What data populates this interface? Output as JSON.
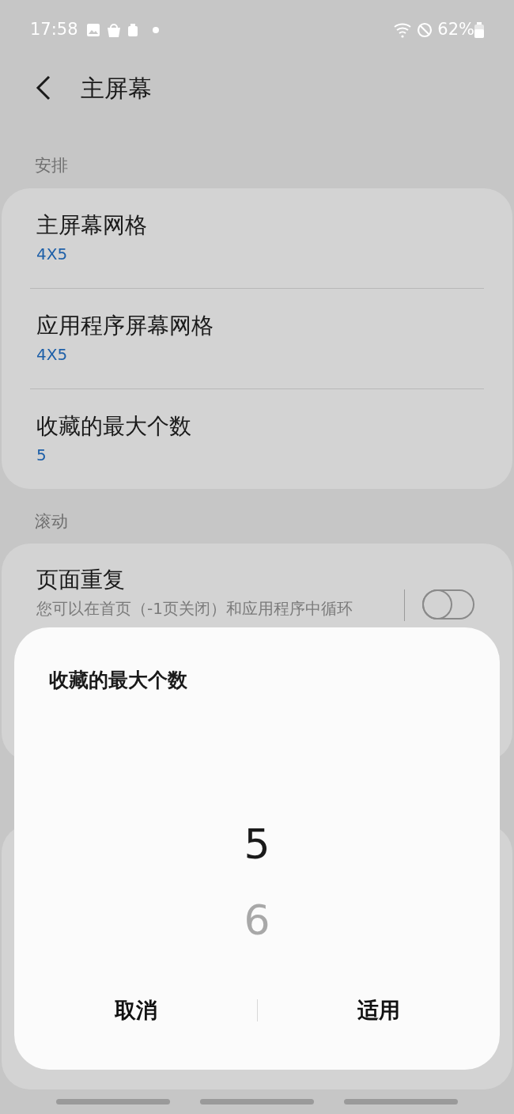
{
  "status_bar": {
    "time": "17:58",
    "battery": "62%"
  },
  "header": {
    "title": "主屏幕"
  },
  "sections": [
    {
      "title": "安排",
      "items": [
        {
          "kind": "value",
          "title": "主屏幕网格",
          "value": "4X5"
        },
        {
          "kind": "value",
          "title": "应用程序屏幕网格",
          "value": "4X5"
        },
        {
          "kind": "value",
          "title": "收藏的最大个数",
          "value": "5"
        }
      ]
    },
    {
      "title": "滚动",
      "items": [
        {
          "kind": "switch",
          "title": "页面重复",
          "description": "您可以在首页（-1页关闭）和应用程序中循环",
          "on": false
        }
      ]
    }
  ],
  "dialog": {
    "title": "收藏的最大个数",
    "options": [
      {
        "label": "5",
        "selected": true
      },
      {
        "label": "6",
        "selected": false
      }
    ],
    "buttons": [
      "取消",
      "适用"
    ]
  }
}
